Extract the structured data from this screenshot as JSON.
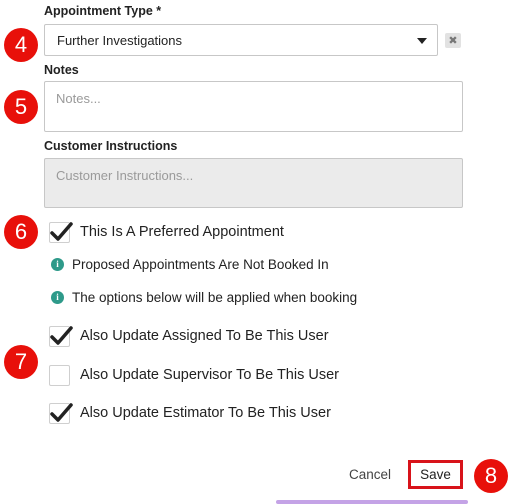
{
  "appointment_type": {
    "label": "Appointment Type *",
    "value": "Further Investigations",
    "clear_glyph": "✖"
  },
  "notes": {
    "label": "Notes",
    "placeholder": "Notes..."
  },
  "customer_instructions": {
    "label": "Customer Instructions",
    "placeholder": "Customer Instructions..."
  },
  "preferred": {
    "label": "This Is A Preferred Appointment",
    "checked": true
  },
  "info": [
    {
      "icon": "info-icon",
      "text": "Proposed Appointments Are Not Booked In"
    },
    {
      "icon": "info-icon",
      "text": "The options below will be applied when booking"
    }
  ],
  "options": [
    {
      "label": "Also Update Assigned To Be This User",
      "checked": true
    },
    {
      "label": "Also Update Supervisor To Be This User",
      "checked": false
    },
    {
      "label": "Also Update Estimator To Be This User",
      "checked": true
    }
  ],
  "actions": {
    "cancel_label": "Cancel",
    "save_label": "Save"
  },
  "step_badges": [
    "4",
    "5",
    "6",
    "7",
    "8"
  ],
  "colors": {
    "badge_red": "#e8100a",
    "info_teal": "#2e9a8a",
    "save_border": "#d8131a"
  }
}
